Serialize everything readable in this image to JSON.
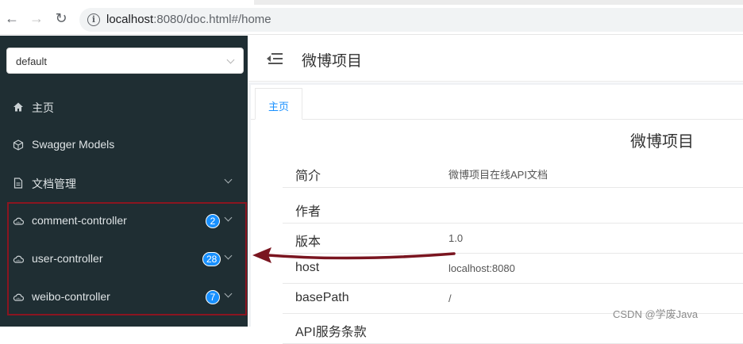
{
  "browser": {
    "url_host": "localhost",
    "url_path": ":8080/doc.html#/home"
  },
  "sidebar": {
    "group_select": "default",
    "items": [
      {
        "label": "主页",
        "icon": "home-icon"
      },
      {
        "label": "Swagger Models",
        "icon": "model-icon"
      },
      {
        "label": "文档管理",
        "icon": "document-icon"
      },
      {
        "label": "comment-controller",
        "icon": "cloud-icon",
        "badge": "2"
      },
      {
        "label": "user-controller",
        "icon": "cloud-icon",
        "badge": "28"
      },
      {
        "label": "weibo-controller",
        "icon": "cloud-icon",
        "badge": "7"
      }
    ]
  },
  "header": {
    "title": "微博项目"
  },
  "tabs": [
    {
      "label": "主页",
      "active": true
    }
  ],
  "doc": {
    "title": "微博项目",
    "rows": [
      {
        "key": "简介",
        "value": "微博项目在线API文档"
      },
      {
        "key": "作者",
        "value": ""
      },
      {
        "key": "版本",
        "value": "1.0"
      },
      {
        "key": "host",
        "value": "localhost:8080"
      },
      {
        "key": "basePath",
        "value": "/"
      },
      {
        "key": "API服务条款",
        "value": ""
      }
    ]
  },
  "watermark": "CSDN @学废Java",
  "colors": {
    "sidebar_bg": "#1f2e33",
    "accent": "#1890ff",
    "annotation": "#8b1520"
  }
}
